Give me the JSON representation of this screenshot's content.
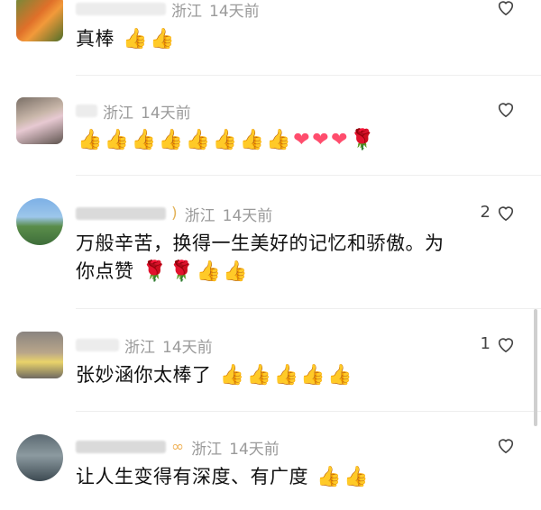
{
  "comments": [
    {
      "location": "浙江",
      "time": "14天前",
      "text": "真棒",
      "emojis": [
        "👍",
        "👍"
      ],
      "likes": ""
    },
    {
      "location": "浙江",
      "time": "14天前",
      "text": "",
      "emojis": [
        "👍",
        "👍",
        "👍",
        "👍",
        "👍",
        "👍",
        "👍",
        "👍",
        "❤",
        "❤",
        "❤",
        "🌹"
      ],
      "likes": ""
    },
    {
      "location": "浙江",
      "time": "14天前",
      "text_line1": "万般辛苦，换得一生美好的记忆和骄傲。为",
      "text_line2": "你点赞",
      "emojis": [
        "🌹",
        "🌹",
        "👍",
        "👍"
      ],
      "likes": "2"
    },
    {
      "location": "浙江",
      "time": "14天前",
      "text": "张妙涵你太棒了",
      "emojis": [
        "👍",
        "👍",
        "👍",
        "👍",
        "👍"
      ],
      "likes": "1"
    },
    {
      "location": "浙江",
      "time": "14天前",
      "text": "让人生变得有深度、有广度",
      "emojis": [
        "👍",
        "👍"
      ],
      "likes": ""
    }
  ],
  "icons": {
    "like": "heart-outline-icon"
  },
  "colors": {
    "meta": "#9a9a9a",
    "text": "#111111"
  }
}
